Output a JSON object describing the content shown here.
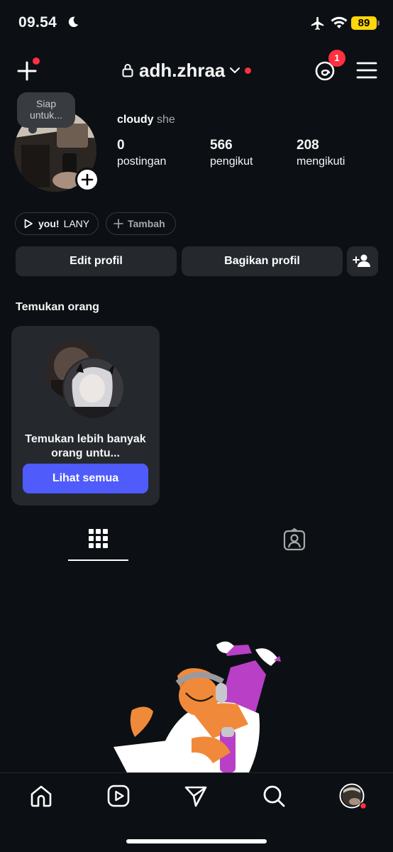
{
  "status_bar": {
    "time": "09.54",
    "battery": "89"
  },
  "header": {
    "username": "adh.zhraa",
    "threads_badge": "1"
  },
  "profile": {
    "note": "Siap untuk...",
    "name": "cloudy",
    "pronouns": "she",
    "stats": [
      {
        "value": "0",
        "label": "postingan"
      },
      {
        "value": "566",
        "label": "pengikut"
      },
      {
        "value": "208",
        "label": "mengikuti"
      }
    ]
  },
  "highlights": {
    "music_title": "you!",
    "music_artist": "LANY",
    "add_label": "Tambah"
  },
  "actions": {
    "edit": "Edit profil",
    "share": "Bagikan profil"
  },
  "discover": {
    "title": "Temukan orang",
    "card_text": "Temukan lebih banyak orang untu...",
    "see_all": "Lihat semua"
  },
  "colors": {
    "background": "#0c1014",
    "surface": "#25292e",
    "accent": "#4f5bfa",
    "notification": "#ff3040"
  },
  "icons": [
    "moon-icon",
    "airplane-icon",
    "wifi-icon",
    "plus-icon",
    "lock-icon",
    "chevron-down-icon",
    "threads-icon",
    "menu-icon",
    "add-person-icon",
    "play-icon",
    "grid-icon",
    "tagged-icon",
    "home-icon",
    "reels-icon",
    "send-icon",
    "search-icon"
  ]
}
